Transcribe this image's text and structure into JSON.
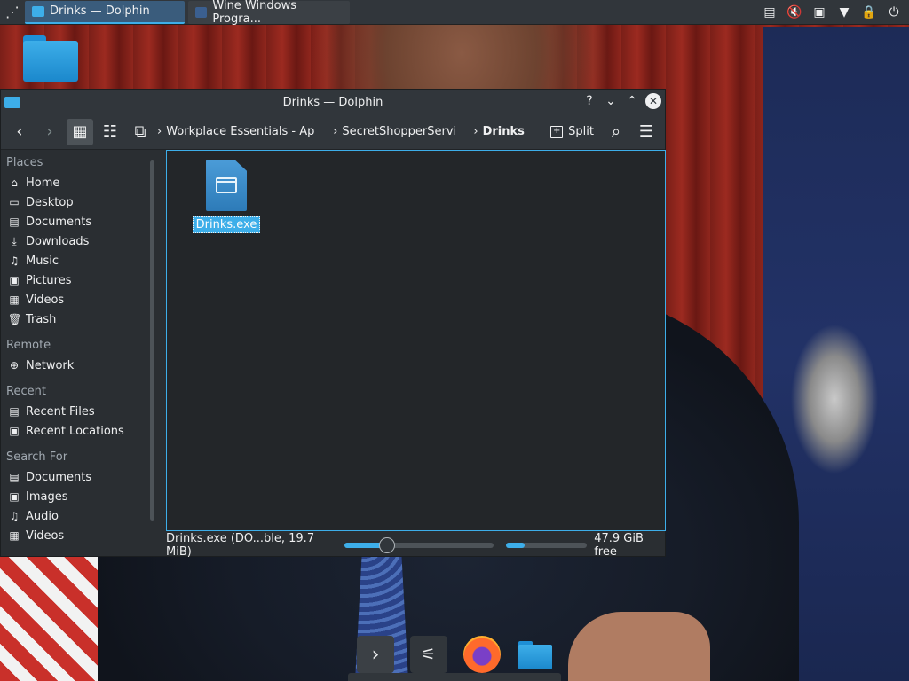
{
  "panel": {
    "tasks": [
      {
        "label": "Drinks — Dolphin",
        "active": true
      },
      {
        "label": "Wine Windows Progra...",
        "active": false
      }
    ],
    "tray_icons": [
      "clipboard-icon",
      "volume-muted-icon",
      "network-icon",
      "expand-arrow-icon",
      "lock-icon",
      "power-icon"
    ]
  },
  "window": {
    "title": "Drinks — Dolphin",
    "buttons": {
      "help": "?",
      "minimize": "⌄",
      "maximize": "⌃",
      "close": "✕"
    }
  },
  "toolbar": {
    "breadcrumbs": [
      {
        "label": "Workplace Essentials - April"
      },
      {
        "label": "SecretShopperServic"
      },
      {
        "label": "Drinks"
      }
    ],
    "split_label": "Split"
  },
  "sidebar": {
    "sections": [
      {
        "title": "Places",
        "items": [
          {
            "label": "Home",
            "icon": "home-icon"
          },
          {
            "label": "Desktop",
            "icon": "desktop-icon"
          },
          {
            "label": "Documents",
            "icon": "documents-icon"
          },
          {
            "label": "Downloads",
            "icon": "downloads-icon"
          },
          {
            "label": "Music",
            "icon": "music-icon"
          },
          {
            "label": "Pictures",
            "icon": "pictures-icon"
          },
          {
            "label": "Videos",
            "icon": "videos-icon"
          },
          {
            "label": "Trash",
            "icon": "trash-icon"
          }
        ]
      },
      {
        "title": "Remote",
        "items": [
          {
            "label": "Network",
            "icon": "network-icon"
          }
        ]
      },
      {
        "title": "Recent",
        "items": [
          {
            "label": "Recent Files",
            "icon": "recent-files-icon"
          },
          {
            "label": "Recent Locations",
            "icon": "recent-locations-icon"
          }
        ]
      },
      {
        "title": "Search For",
        "items": [
          {
            "label": "Documents",
            "icon": "documents-icon"
          },
          {
            "label": "Images",
            "icon": "images-icon"
          },
          {
            "label": "Audio",
            "icon": "audio-icon"
          },
          {
            "label": "Videos",
            "icon": "videos-icon"
          }
        ]
      }
    ]
  },
  "files": [
    {
      "name": "Drinks.exe",
      "selected": true,
      "icon": "windows-executable-icon"
    }
  ],
  "status": {
    "selection_text": "Drinks.exe (DO...ble, 19.7 MiB)",
    "zoom_level": 0.27,
    "space_used_fraction": 0.22,
    "free_text": "47.9 GiB free"
  },
  "dock": {
    "items": [
      "show-desktop-icon",
      "system-settings-icon",
      "firefox-icon",
      "dolphin-folder-icon"
    ]
  },
  "colors": {
    "accent": "#3daee9",
    "window_bg": "#2a2e32",
    "view_bg": "#232629",
    "panel_bg": "#31363b"
  }
}
